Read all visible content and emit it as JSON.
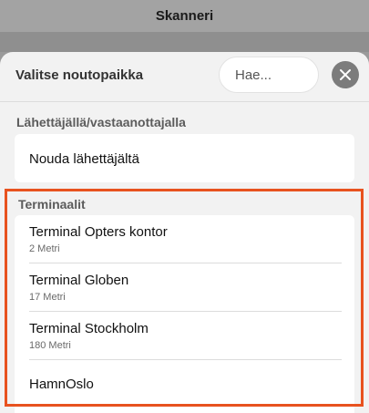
{
  "app": {
    "title": "Skanneri"
  },
  "sheet": {
    "title": "Valitse noutopaikka",
    "search": {
      "placeholder": "Hae..."
    },
    "close_icon": "close-icon"
  },
  "sections": {
    "sender": {
      "label": "Lähettäjällä/vastaanottajalla",
      "items": [
        {
          "name": "Nouda lähettäjältä"
        }
      ]
    },
    "terminals": {
      "label": "Terminaalit",
      "items": [
        {
          "name": "Terminal Opters kontor",
          "distance": "2 Metri"
        },
        {
          "name": "Terminal Globen",
          "distance": "17 Metri"
        },
        {
          "name": "Terminal Stockholm",
          "distance": "180 Metri"
        },
        {
          "name": "HamnOslo",
          "distance": ""
        }
      ]
    }
  },
  "colors": {
    "highlight": "#e8521f",
    "overlay": "#9a9a9a"
  }
}
